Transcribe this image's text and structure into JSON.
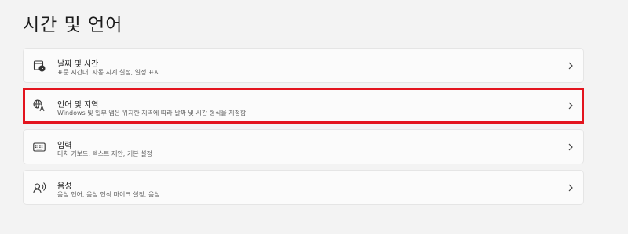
{
  "page": {
    "title": "시간 및 언어"
  },
  "settings": [
    {
      "title": "날짜 및 시간",
      "subtitle": "표준 시간대, 자동 시계 설정, 일정 표시",
      "icon": "calendar-clock-icon"
    },
    {
      "title": "언어 및 지역",
      "subtitle": "Windows 및 일부 앱은 위치한 지역에 따라 날짜 및 시간 형식을 지정함",
      "icon": "language-icon",
      "highlighted": true,
      "highlight_color": "#e3141e"
    },
    {
      "title": "입력",
      "subtitle": "터치 키보드, 텍스트 제안, 기본 설정",
      "icon": "keyboard-icon"
    },
    {
      "title": "음성",
      "subtitle": "음성 언어, 음성 인식 마이크 설정, 음성",
      "icon": "speech-icon"
    }
  ]
}
